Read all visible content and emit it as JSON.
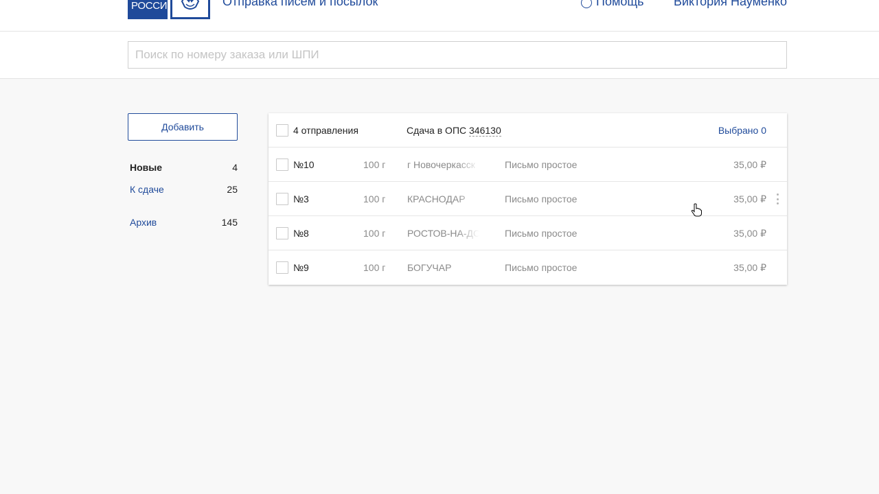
{
  "header": {
    "logo_text": "РОССИИ",
    "app_title": "Отправка писем и посылок",
    "help_label": "Помощь",
    "user_name": "Виктория Науменко"
  },
  "search": {
    "placeholder": "Поиск по номеру заказа или ШПИ",
    "value": ""
  },
  "sidebar": {
    "add_button": "Добавить",
    "items": [
      {
        "label": "Новые",
        "count": "4"
      },
      {
        "label": "К сдаче",
        "count": "25"
      },
      {
        "label": "Архив",
        "count": "145"
      }
    ]
  },
  "table": {
    "header": {
      "count_label": "4 отправления",
      "handover_label": "Сдача в ОПС",
      "ops_number": "346130",
      "selected_label": "Выбрано 0"
    },
    "rows": [
      {
        "num": "№10",
        "weight": "100 г",
        "city": "г Новочеркасск",
        "type": "Письмо простое",
        "price": "35,00 ₽"
      },
      {
        "num": "№3",
        "weight": "100 г",
        "city": "КРАСНОДАР",
        "type": "Письмо простое",
        "price": "35,00 ₽"
      },
      {
        "num": "№8",
        "weight": "100 г",
        "city": "РОСТОВ-НА-ДОНУ",
        "type": "Письмо простое",
        "price": "35,00 ₽"
      },
      {
        "num": "№9",
        "weight": "100 г",
        "city": "БОГУЧАР",
        "type": "Письмо простое",
        "price": "35,00 ₽"
      }
    ]
  },
  "icons": {
    "brand_color": "#1f4a9a",
    "emblem": "eagle-emblem-icon",
    "help": "question-circle-icon",
    "row_menu": "more-vertical-icon",
    "cursor": "hand-pointer-icon"
  }
}
